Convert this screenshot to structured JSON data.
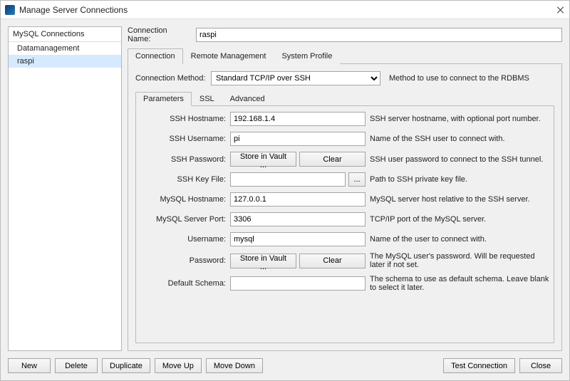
{
  "window": {
    "title": "Manage Server Connections"
  },
  "sidebar": {
    "heading": "MySQL Connections",
    "items": [
      "Datamanagement",
      "raspi"
    ],
    "selected_index": 1
  },
  "connection_name": {
    "label": "Connection Name:",
    "value": "raspi"
  },
  "outer_tabs": [
    "Connection",
    "Remote Management",
    "System Profile"
  ],
  "outer_active": 0,
  "method": {
    "label": "Connection Method:",
    "value": "Standard TCP/IP over SSH",
    "hint": "Method to use to connect to the RDBMS"
  },
  "inner_tabs": [
    "Parameters",
    "SSL",
    "Advanced"
  ],
  "inner_active": 0,
  "params": {
    "ssh_host": {
      "label": "SSH Hostname:",
      "value": "192.168.1.4",
      "hint": "SSH server hostname, with  optional port number."
    },
    "ssh_user": {
      "label": "SSH Username:",
      "value": "pi",
      "hint": "Name of the SSH user to connect with."
    },
    "ssh_pass": {
      "label": "SSH Password:",
      "store": "Store in Vault ...",
      "clear": "Clear",
      "hint": "SSH user password to connect to the SSH tunnel."
    },
    "ssh_key": {
      "label": "SSH Key File:",
      "value": "",
      "browse": "...",
      "hint": "Path to SSH private key file."
    },
    "my_host": {
      "label": "MySQL Hostname:",
      "value": "127.0.0.1",
      "hint": "MySQL server host relative to the SSH server."
    },
    "my_port": {
      "label": "MySQL Server Port:",
      "value": "3306",
      "hint": "TCP/IP port of the MySQL server."
    },
    "username": {
      "label": "Username:",
      "value": "mysql",
      "hint": "Name of the user to connect with."
    },
    "password": {
      "label": "Password:",
      "store": "Store in Vault ...",
      "clear": "Clear",
      "hint": "The MySQL user's password. Will be requested later if not set."
    },
    "schema": {
      "label": "Default Schema:",
      "value": "",
      "hint": "The schema to use as default schema. Leave blank to select it later."
    }
  },
  "buttons": {
    "new": "New",
    "delete": "Delete",
    "duplicate": "Duplicate",
    "moveup": "Move Up",
    "movedown": "Move Down",
    "test": "Test Connection",
    "close": "Close"
  }
}
